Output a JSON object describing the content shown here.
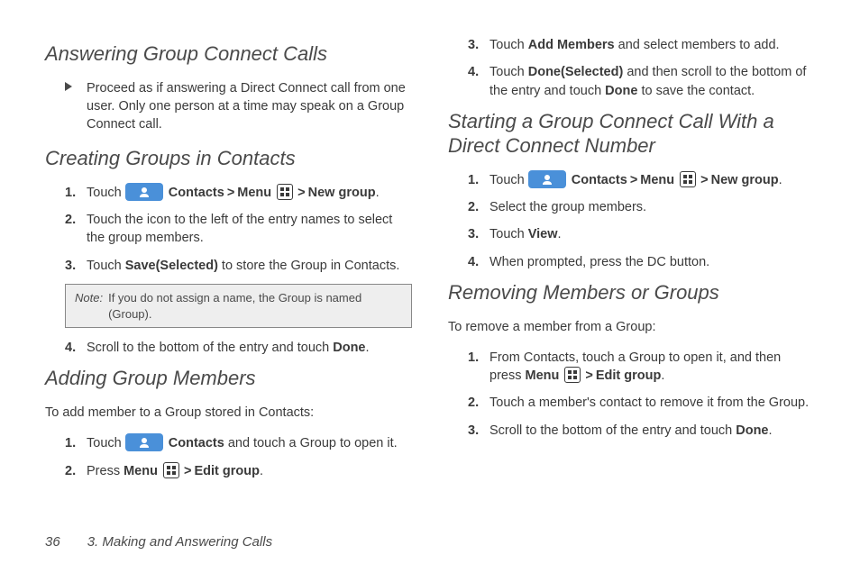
{
  "left": {
    "h1": "Answering Group Connect Calls",
    "bullet1": "Proceed as if answering a Direct Connect call from one user. Only one person at a time may speak on a Group Connect call.",
    "h2": "Creating Groups in Contacts",
    "s2": {
      "i1a": "Touch ",
      "i1_contacts": " Contacts",
      "i1_menu": "Menu",
      "i1_newgroup": "New group",
      "i1_end": ".",
      "i2": "Touch the icon to the left of the entry names to select the group members.",
      "i3a": "Touch ",
      "i3b": "Save(Selected)",
      "i3c": " to store the Group in Contacts.",
      "i4a": "Scroll to the bottom of the entry and touch ",
      "i4b": "Done",
      "i4c": "."
    },
    "note_label": "Note:",
    "note_text": "If you do not assign a name, the Group is named (Group).",
    "h3": "Adding Group Members",
    "intro3": "To add member to a Group stored in Contacts:",
    "s3": {
      "i1a": "Touch ",
      "i1_contacts": " Contacts",
      "i1b": " and touch a Group to open it.",
      "i2a": "Press ",
      "i2_menu": "Menu",
      "i2_edit": "Edit group",
      "i2_end": "."
    }
  },
  "right": {
    "cont": {
      "i3a": "Touch ",
      "i3b": "Add Members",
      "i3c": " and select members to add.",
      "i4a": "Touch ",
      "i4b": "Done(Selected)",
      "i4c": " and then scroll to the bottom of the entry and touch ",
      "i4d": "Done",
      "i4e": " to save the contact."
    },
    "h4": "Starting a Group Connect Call With a Direct Connect Number",
    "s4": {
      "i1a": "Touch ",
      "i1_contacts": " Contacts",
      "i1_menu": "Menu",
      "i1_newgroup": "New group",
      "i1_end": ".",
      "i2": "Select the group members.",
      "i3a": "Touch ",
      "i3b": "View",
      "i3c": ".",
      "i4": "When prompted, press the DC button."
    },
    "h5": "Removing Members or Groups",
    "intro5": "To remove a member from a Group:",
    "s5": {
      "i1a": "From Contacts, touch a Group to open it, and then press ",
      "i1_menu": "Menu",
      "i1_edit": "Edit group",
      "i1_end": ".",
      "i2": "Touch a member's contact to remove it from the Group.",
      "i3a": "Scroll to the bottom of the entry and touch ",
      "i3b": "Done",
      "i3c": "."
    }
  },
  "footer": {
    "page": "36",
    "chapter": "3. Making and Answering Calls"
  },
  "gt": ">"
}
